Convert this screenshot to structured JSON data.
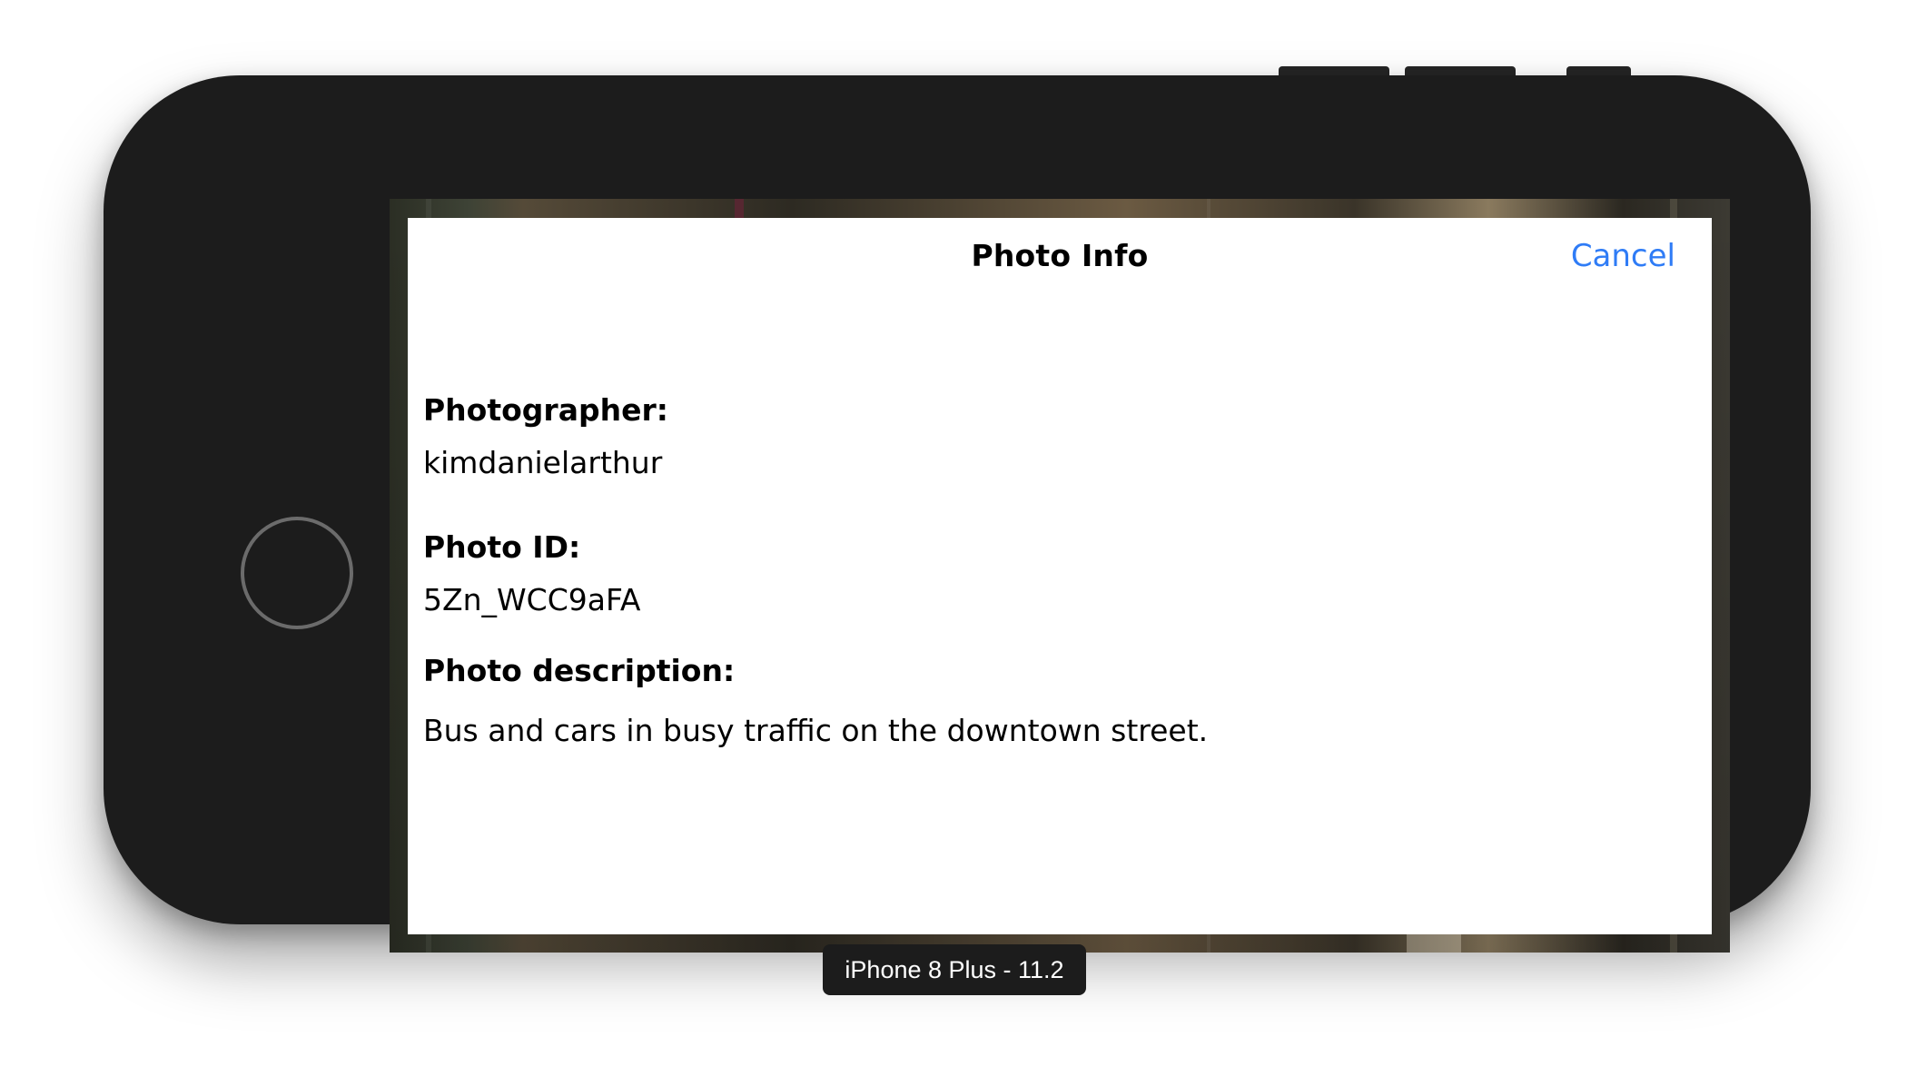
{
  "modal": {
    "title": "Photo Info",
    "cancel_label": "Cancel"
  },
  "photo": {
    "photographer_label": "Photographer:",
    "photographer_value": "kimdanielarthur",
    "id_label": "Photo ID:",
    "id_value": "5Zn_WCC9aFA",
    "description_label": "Photo description:",
    "description_value": "Bus and cars in busy traffic on the downtown street."
  },
  "simulator": {
    "device_label": "iPhone 8 Plus - 11.2"
  },
  "colors": {
    "accent": "#2f7cf6",
    "device_body": "#1c1c1c"
  }
}
